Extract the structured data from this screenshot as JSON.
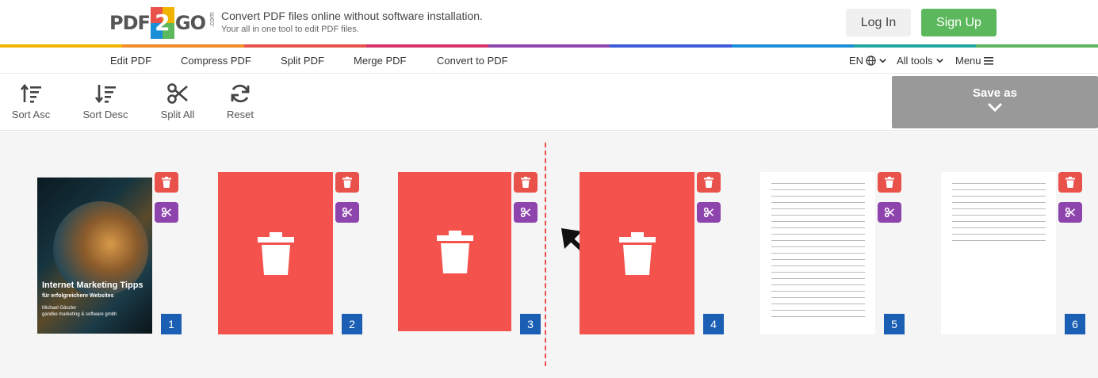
{
  "header": {
    "tagline": "Convert PDF files online without software installation.",
    "subtagline": "Your all in one tool to edit PDF files.",
    "login_label": "Log In",
    "signup_label": "Sign Up",
    "logo": {
      "left": "PDF",
      "mid": "2",
      "right": "GO",
      "suffix": ".com"
    }
  },
  "nav": {
    "items": [
      "Edit PDF",
      "Compress PDF",
      "Split PDF",
      "Merge PDF",
      "Convert to PDF"
    ],
    "lang": "EN",
    "all_tools": "All tools",
    "menu": "Menu"
  },
  "toolbar": {
    "sort_asc": "Sort Asc",
    "sort_desc": "Sort Desc",
    "split_all": "Split All",
    "reset": "Reset",
    "save_as": "Save as"
  },
  "pages": [
    {
      "number": "1",
      "state": "cover",
      "cover_title": "Internet Marketing Tipps",
      "cover_subtitle": "für erfolgreichere Websites",
      "cover_author": "Michael Gänzler",
      "cover_company": "gandke marketing & software gmbh"
    },
    {
      "number": "2",
      "state": "deleted"
    },
    {
      "number": "3",
      "state": "deleted"
    },
    {
      "number": "4",
      "state": "deleted"
    },
    {
      "number": "5",
      "state": "toc"
    },
    {
      "number": "6",
      "state": "toc"
    }
  ],
  "colors": {
    "delete": "#e8524a",
    "split": "#8e44ad",
    "page_number": "#1a5fb4",
    "signup": "#5cb85c",
    "save_as": "#999999"
  }
}
